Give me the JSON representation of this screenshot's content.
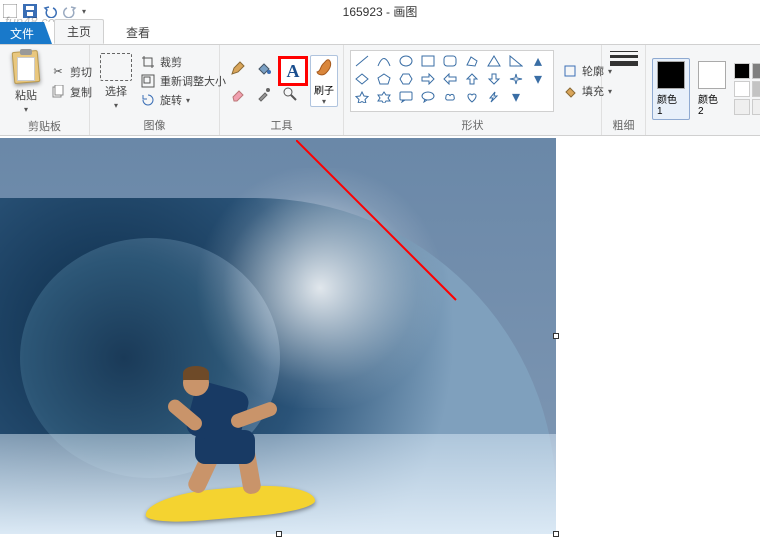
{
  "title": "165923 - 画图",
  "watermark": "fun48.com",
  "tabs": {
    "file": "文件",
    "home": "主页",
    "view": "查看"
  },
  "clipboard": {
    "paste": "粘贴",
    "cut": "剪切",
    "copy": "复制",
    "group": "剪贴板"
  },
  "image": {
    "select": "选择",
    "crop": "裁剪",
    "resize": "重新调整大小",
    "rotate": "旋转",
    "group": "图像"
  },
  "tools": {
    "group": "工具",
    "text_tool": "A"
  },
  "brush": {
    "label": "刷子"
  },
  "shapes": {
    "group": "形状",
    "outline": "轮廓",
    "fill": "填充"
  },
  "thickness": {
    "label": "粗细"
  },
  "colors": {
    "c1": "颜色 1",
    "c2": "颜色 2",
    "c1_hex": "#000000",
    "c2_hex": "#ffffff"
  },
  "palette": [
    "#000000",
    "#7f7f7f",
    "#880015",
    "#ed1c24",
    "#ff7f27",
    "#ffffff",
    "#c3c3c3",
    "#b97a57",
    "#ffaec9",
    "#ffc90e",
    "#efefef",
    "#efefef",
    "#efefef",
    "#efefef",
    "#efefef"
  ]
}
